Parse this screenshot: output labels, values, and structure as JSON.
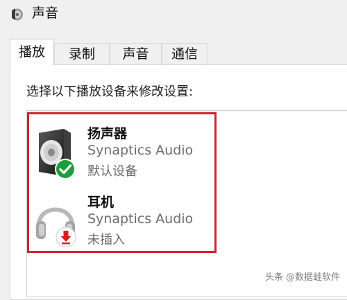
{
  "window": {
    "title": "声音",
    "icon": "speaker-app-icon"
  },
  "tabs": [
    {
      "label": "播放",
      "active": true
    },
    {
      "label": "录制",
      "active": false
    },
    {
      "label": "声音",
      "active": false
    },
    {
      "label": "通信",
      "active": false
    }
  ],
  "playback": {
    "instruction": "选择以下播放设备来修改设置:",
    "devices": [
      {
        "name": "扬声器",
        "driver": "Synaptics Audio",
        "status": "默认设备",
        "icon": "speaker-icon",
        "badge_icon": "default-check-icon",
        "badge_color": "#1f9d3a"
      },
      {
        "name": "耳机",
        "driver": "Synaptics Audio",
        "status": "未插入",
        "icon": "headphones-icon",
        "badge_icon": "unplugged-arrow-icon",
        "badge_color": "#d42020"
      }
    ],
    "highlight_color": "#d3202e"
  },
  "watermark": "头条 @数据蛙软件"
}
